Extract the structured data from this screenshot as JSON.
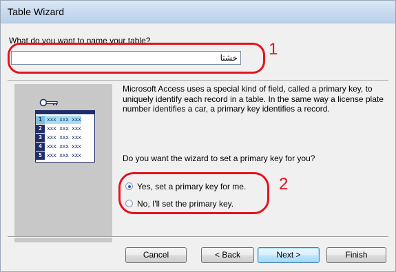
{
  "window": {
    "title": "Table Wizard"
  },
  "naming": {
    "question": "What do you want to name your table?",
    "table_name_value": "خشتا"
  },
  "description": "Microsoft Access uses a special kind of field, called a primary key, to uniquely identify each record in a table. In the same way a license plate number identifies a car, a primary key identifies a record.",
  "primary_key": {
    "prompt": "Do you want the wizard to set a primary key for you?",
    "options": [
      {
        "label": "Yes, set a primary key for me.",
        "checked": true
      },
      {
        "label": "No, I'll set the primary key.",
        "checked": false
      }
    ]
  },
  "illustration": {
    "icon": "key-icon",
    "rows": [
      {
        "num": "1",
        "text": "xxx xxx xxx"
      },
      {
        "num": "2",
        "text": "xxx xxx xxx"
      },
      {
        "num": "3",
        "text": "xxx xxx xxx"
      },
      {
        "num": "4",
        "text": "xxx xxx xxx"
      },
      {
        "num": "5",
        "text": "xxx xxx xxx"
      }
    ]
  },
  "annotations": {
    "marker_1": "1",
    "marker_2": "2",
    "color": "#e5121e"
  },
  "buttons": {
    "cancel": "Cancel",
    "back": "< Back",
    "next": "Next >",
    "finish": "Finish"
  }
}
